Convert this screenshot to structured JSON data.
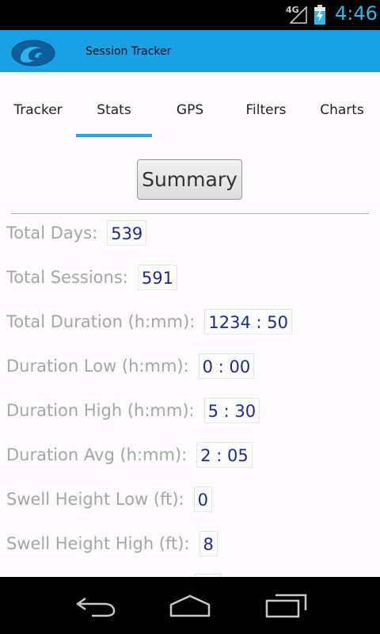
{
  "status_bar": {
    "network": "4G",
    "time": "4:46",
    "signal_icon": "signal-icon",
    "battery_icon": "battery-charging-icon",
    "accent": "#33b5e5"
  },
  "action_bar": {
    "title": "Session Tracker",
    "logo_icon": "wave-logo-icon",
    "color": "#1aa0e6"
  },
  "tabs": [
    {
      "label": "Tracker"
    },
    {
      "label": "Stats",
      "selected": true
    },
    {
      "label": "GPS"
    },
    {
      "label": "Filters"
    },
    {
      "label": "Charts"
    }
  ],
  "summary_button": "Summary",
  "stats": [
    {
      "label": "Total Days:",
      "value": "539"
    },
    {
      "label": "Total Sessions:",
      "value": "591"
    },
    {
      "label": "Total Duration (h:mm):",
      "value": "1234 : 50"
    },
    {
      "label": "Duration Low (h:mm):",
      "value": "0 : 00"
    },
    {
      "label": "Duration High (h:mm):",
      "value": "5 : 30"
    },
    {
      "label": "Duration Avg (h:mm):",
      "value": "2 : 05"
    },
    {
      "label": "Swell Height Low (ft):",
      "value": "0"
    },
    {
      "label": "Swell Height High (ft):",
      "value": "8"
    }
  ],
  "nav_bar": {
    "back_icon": "back-icon",
    "home_icon": "home-icon",
    "recents_icon": "recents-icon"
  }
}
